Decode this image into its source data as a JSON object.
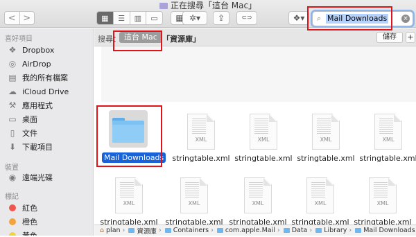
{
  "window": {
    "title": "正在搜尋「這台 Mac」"
  },
  "toolbar": {
    "back": "<",
    "forward": ">",
    "view_modes": [
      "icon",
      "list",
      "column",
      "gallery"
    ],
    "share": "⇪",
    "tag": "⊂⊃",
    "dropbox": "▼"
  },
  "search": {
    "value": "Mail Downloads",
    "clear": "×",
    "icon": "magnifier-icon"
  },
  "sidebar": {
    "favorites_title": "喜好項目",
    "favorites": [
      {
        "label": "Dropbox",
        "icon": "dropbox-icon"
      },
      {
        "label": "AirDrop",
        "icon": "airdrop-icon"
      },
      {
        "label": "我的所有檔案",
        "icon": "all-files-icon"
      },
      {
        "label": "iCloud Drive",
        "icon": "cloud-icon"
      },
      {
        "label": "應用程式",
        "icon": "applications-icon"
      },
      {
        "label": "桌面",
        "icon": "desktop-icon"
      },
      {
        "label": "文件",
        "icon": "documents-icon"
      },
      {
        "label": "下載項目",
        "icon": "downloads-icon"
      }
    ],
    "devices_title": "裝置",
    "devices": [
      {
        "label": "遠端光碟",
        "icon": "disc-icon"
      }
    ],
    "tags_title": "標記",
    "tags": [
      {
        "label": "紅色",
        "color": "#f0564c"
      },
      {
        "label": "橙色",
        "color": "#f4a33a"
      },
      {
        "label": "黃色",
        "color": "#f5d23a"
      }
    ]
  },
  "scope": {
    "label": "搜尋：",
    "active": "這台 Mac",
    "other": "「資源庫」",
    "save": "儲存",
    "add": "+"
  },
  "results": [
    {
      "name": "Mail Downloads",
      "kind": "folder",
      "selected": true
    },
    {
      "name": "stringtable.xml",
      "kind": "xml"
    },
    {
      "name": "stringtable.xml",
      "kind": "xml"
    },
    {
      "name": "stringtable.xml",
      "kind": "xml"
    },
    {
      "name": "stringtable.xml",
      "kind": "xml"
    },
    {
      "name": "stringtable.xml",
      "kind": "xml"
    },
    {
      "name": "stringtable.xml",
      "kind": "xml"
    },
    {
      "name": "stringtable.xml",
      "kind": "xml"
    },
    {
      "name": "stringtable.xml",
      "kind": "xml"
    },
    {
      "name": "stringtable.xml",
      "kind": "xml"
    }
  ],
  "file_ext": "XML",
  "pathbar": [
    "plan",
    "資源庫",
    "Containers",
    "com.apple.Mail",
    "Data",
    "Library",
    "Mail Downloads"
  ]
}
